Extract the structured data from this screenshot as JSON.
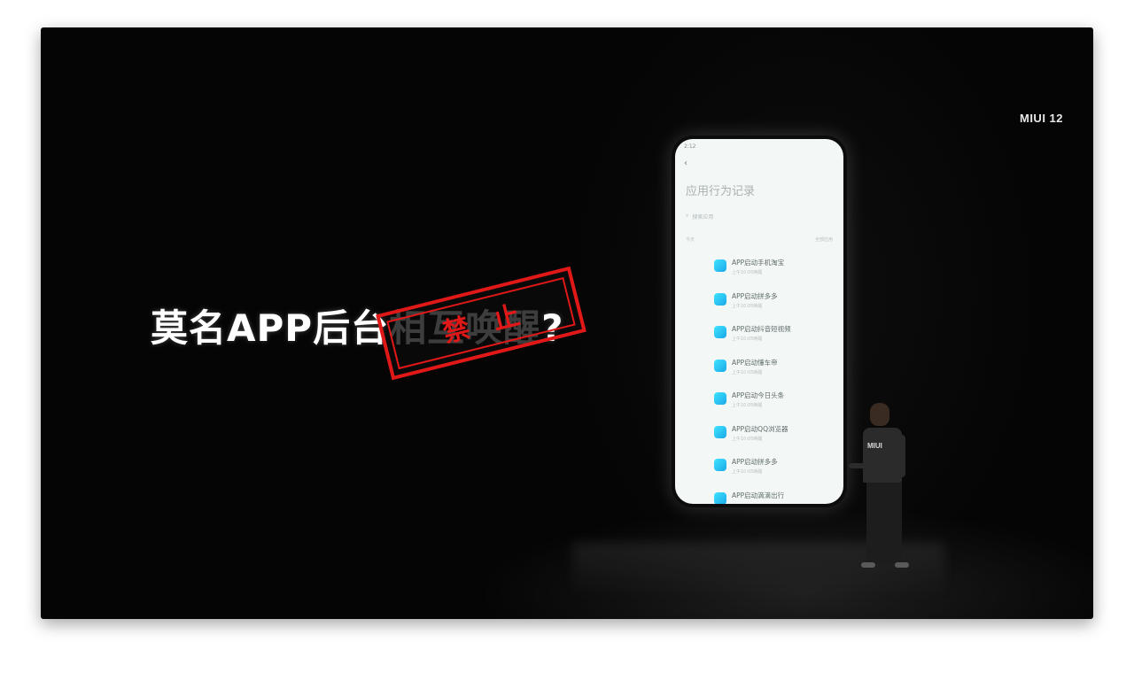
{
  "brand": "MIUI 12",
  "headline": {
    "part1": "莫名APP后台",
    "part2": "相互唤醒",
    "part3": "?"
  },
  "stamp": {
    "text": "禁止"
  },
  "phone": {
    "status_left": "2:12",
    "status_right": "",
    "screen_title": "应用行为记录",
    "search_placeholder": "搜索应用",
    "section_left": "今天",
    "section_right": "全部应用",
    "items": [
      {
        "title": "APP启动手机淘宝",
        "sub": "上午10:05唤醒"
      },
      {
        "title": "APP启动拼多多",
        "sub": "上午10:05唤醒"
      },
      {
        "title": "APP启动抖音短视频",
        "sub": "上午10:05唤醒"
      },
      {
        "title": "APP启动懂车帝",
        "sub": "上午10:05唤醒"
      },
      {
        "title": "APP启动今日头条",
        "sub": "上午10:05唤醒"
      },
      {
        "title": "APP启动QQ浏览器",
        "sub": "上午10:05唤醒"
      },
      {
        "title": "APP启动拼多多",
        "sub": "上午10:05唤醒"
      },
      {
        "title": "APP启动滴滴出行",
        "sub": ""
      }
    ]
  },
  "presenter": {
    "shirt_logo": "MIUI"
  },
  "colors": {
    "stamp": "#e01818",
    "app_icon": "#2ec4f2",
    "background": "#050505"
  }
}
